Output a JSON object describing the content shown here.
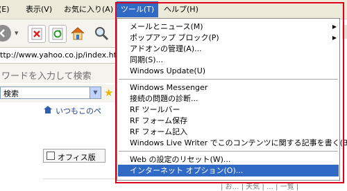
{
  "menubar": {
    "edit_label": "(E)",
    "view_label": "表示(V)",
    "favorites_label": "お気に入り(A)",
    "tools_label": "ツール(T)",
    "help_label": "ヘルプ(H)"
  },
  "address": {
    "url": "ttp://www.yahoo.co.jp/index.html"
  },
  "search": {
    "placeholder": "ワードを入力して検索",
    "engine": "検索"
  },
  "page": {
    "link_text": "いつもこのペ",
    "office_label": "オフィス版",
    "bottom_nav": "| お… | 天気 | … | 一覧 |"
  },
  "tools_menu": {
    "items": [
      {
        "label": "メールとニュース(M)",
        "has_submenu": true
      },
      {
        "label": "ポップアップ ブロック(P)",
        "has_submenu": true
      },
      {
        "label": "アドオンの管理(A)...",
        "has_submenu": false
      },
      {
        "label": "同期(S)...",
        "has_submenu": false
      },
      {
        "label": "Windows Update(U)",
        "has_submenu": false
      },
      {
        "label": "Windows Messenger",
        "has_submenu": false
      },
      {
        "label": "接続の問題の診断...",
        "has_submenu": false
      },
      {
        "label": "RF ツールバー",
        "has_submenu": false
      },
      {
        "label": "RF フォーム保存",
        "has_submenu": false
      },
      {
        "label": "RF フォーム記入",
        "has_submenu": false
      },
      {
        "label": "Windows Live Writer でこのコンテンツに関する記事を書く(B)",
        "has_submenu": false
      },
      {
        "label": "Web の設定のリセット(W)...",
        "has_submenu": false
      },
      {
        "label": "インターネット オプション(O)...",
        "has_submenu": false
      }
    ]
  },
  "colors": {
    "highlight": "#316ac5",
    "annotation_frame": "#e0001b",
    "menubar_bg": "#ece9d8"
  },
  "icons": [
    "back-icon",
    "stop-icon",
    "refresh-icon",
    "home-icon",
    "search-icon",
    "favorites-star-icon",
    "office-icon"
  ]
}
